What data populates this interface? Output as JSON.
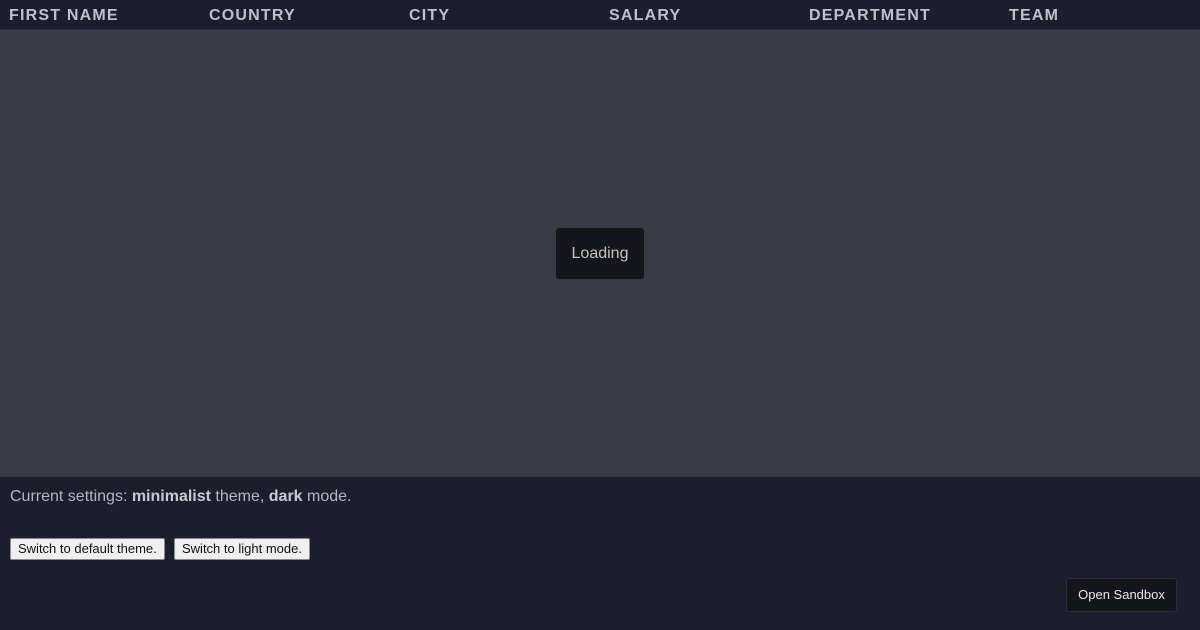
{
  "grid": {
    "columns": [
      "FIRST NAME",
      "COUNTRY",
      "CITY",
      "SALARY",
      "DEPARTMENT",
      "TEAM"
    ],
    "loading_text": "Loading"
  },
  "footer": {
    "settings_prefix": "Current settings: ",
    "theme_value": "minimalist",
    "theme_suffix": " theme, ",
    "mode_value": "dark",
    "mode_suffix": " mode.",
    "switch_theme_label": "Switch to default theme.",
    "switch_mode_label": "Switch to light mode.",
    "sandbox_label": "Open Sandbox"
  },
  "colors": {
    "grid_background": "#393b46",
    "header_background": "#1c1e2b",
    "page_background": "#1c1e2b",
    "header_text": "#c0c1c6",
    "loading_background": "#15161b"
  }
}
